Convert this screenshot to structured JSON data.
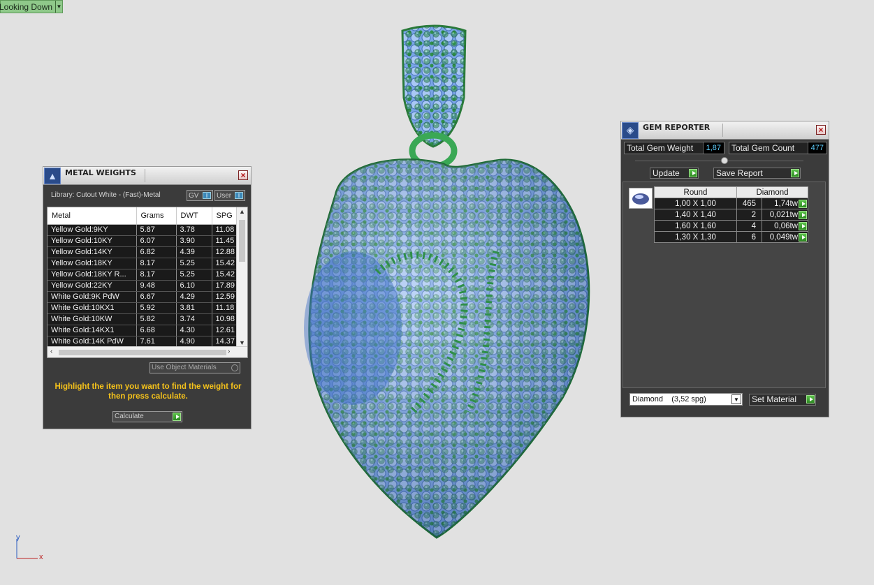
{
  "viewport": {
    "label": "Looking Down",
    "axis_y": "y",
    "axis_x": "x"
  },
  "metal_weights": {
    "title": "METAL WEIGHTS",
    "library": "Library: Cutout White - (Fast)-Metal",
    "toggle_gv": "GV",
    "toggle_user": "User",
    "columns": [
      "Metal",
      "Grams",
      "DWT",
      "SPG"
    ],
    "rows": [
      [
        "Yellow Gold:9KY",
        "5.87",
        "3.78",
        "11.08"
      ],
      [
        "Yellow Gold:10KY",
        "6.07",
        "3.90",
        "11.45"
      ],
      [
        "Yellow Gold:14KY",
        "6.82",
        "4.39",
        "12.88"
      ],
      [
        "Yellow Gold:18KY",
        "8.17",
        "5.25",
        "15.42"
      ],
      [
        "Yellow Gold:18KY R...",
        "8.17",
        "5.25",
        "15.42"
      ],
      [
        "Yellow Gold:22KY",
        "9.48",
        "6.10",
        "17.89"
      ],
      [
        "White Gold:9K PdW",
        "6.67",
        "4.29",
        "12.59"
      ],
      [
        "White Gold:10KX1",
        "5.92",
        "3.81",
        "11.18"
      ],
      [
        "White Gold:10KW",
        "5.82",
        "3.74",
        "10.98"
      ],
      [
        "White Gold:14KX1",
        "6.68",
        "4.30",
        "12.61"
      ],
      [
        "White Gold:14K PdW",
        "7.61",
        "4.90",
        "14.37"
      ]
    ],
    "use_object_materials": "Use Object Materials",
    "hint": "Highlight the item you want to find the weight for then press calculate.",
    "calculate": "Calculate"
  },
  "gem_reporter": {
    "title": "GEM REPORTER",
    "total_weight_label": "Total Gem Weight",
    "total_weight_value": "1,87",
    "total_count_label": "Total Gem Count",
    "total_count_value": "477",
    "update": "Update",
    "save_report": "Save Report",
    "columns": [
      "Round",
      "Diamond"
    ],
    "rows": [
      {
        "size": "1,00 X 1,00",
        "count": "465",
        "weight": "1,74tw"
      },
      {
        "size": "1,40 X 1,40",
        "count": "2",
        "weight": "0,021tw"
      },
      {
        "size": "1,60 X 1,60",
        "count": "4",
        "weight": "0,06tw"
      },
      {
        "size": "1,30 X 1,30",
        "count": "6",
        "weight": "0,049tw"
      }
    ],
    "material": "Diamond    (3,52 spg)",
    "set_material": "Set Material"
  }
}
